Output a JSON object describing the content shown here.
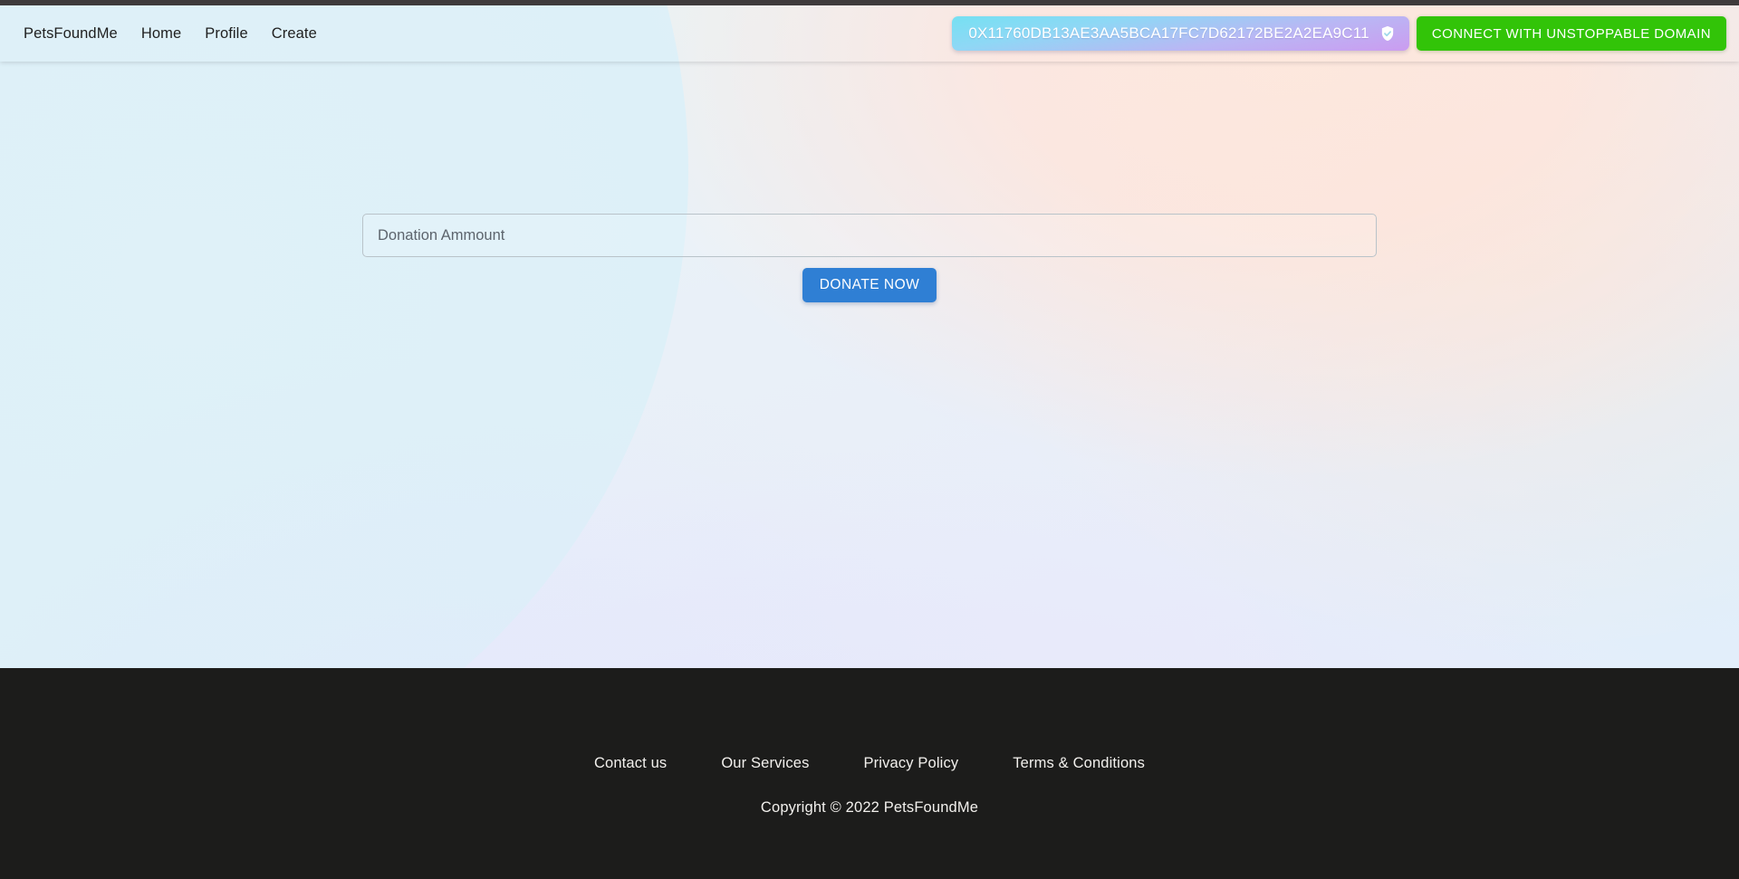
{
  "navbar": {
    "brand": "PetsFoundMe",
    "links": [
      {
        "label": "Home"
      },
      {
        "label": "Profile"
      },
      {
        "label": "Create"
      }
    ],
    "wallet": {
      "address": "0X11760DB13AE3AA5BCA17FC7D62172BE2A2EA9C11",
      "verified_icon": "shield-check-icon",
      "gradient_from": "#76e0f2",
      "gradient_to": "#cb9cf0"
    },
    "connect_button": {
      "label": "CONNECT WITH UNSTOPPABLE DOMAIN",
      "color": "#32c408"
    }
  },
  "main": {
    "amount_input": {
      "placeholder": "Donation Ammount",
      "value": ""
    },
    "donate_button": {
      "label": "DONATE NOW",
      "color": "#2f7fd4"
    }
  },
  "footer": {
    "background": "#1c1c1b",
    "links": [
      {
        "label": "Contact us"
      },
      {
        "label": "Our Services"
      },
      {
        "label": "Privacy Policy"
      },
      {
        "label": "Terms & Conditions"
      }
    ],
    "copyright": "Copyright © 2022 PetsFoundMe"
  }
}
